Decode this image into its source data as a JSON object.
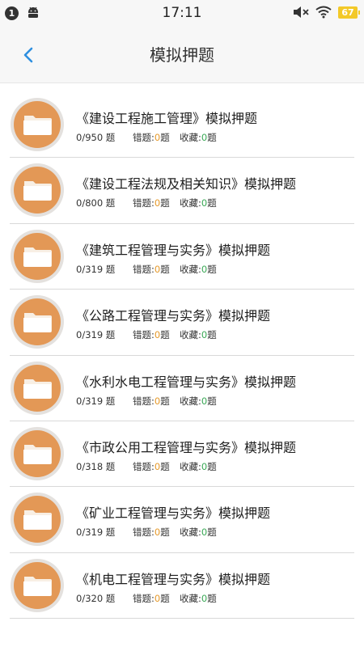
{
  "status_bar": {
    "notification_count": "1",
    "time": "17:11",
    "battery": "67",
    "icons": [
      "android-icon",
      "mute-icon",
      "wifi-icon",
      "battery-icon"
    ]
  },
  "header": {
    "title": "模拟押题",
    "back_icon": "chevron-left-icon"
  },
  "colors": {
    "accent": "#2e8fe0",
    "folder": "#e39856",
    "wrong_count": "#e69a2b",
    "fav_count": "#3aa856",
    "battery": "#f3c928"
  },
  "items": [
    {
      "title": "《建设工程施工管理》模拟押题",
      "progress": "0/950 题",
      "wrong_label": "错题:",
      "wrong_count": "0",
      "wrong_unit": "题",
      "fav_label": "收藏:",
      "fav_count": "0",
      "fav_unit": "题"
    },
    {
      "title": "《建设工程法规及相关知识》模拟押题",
      "progress": "0/800 题",
      "wrong_label": "错题:",
      "wrong_count": "0",
      "wrong_unit": "题",
      "fav_label": "收藏:",
      "fav_count": "0",
      "fav_unit": "题"
    },
    {
      "title": "《建筑工程管理与实务》模拟押题",
      "progress": "0/319 题",
      "wrong_label": "错题:",
      "wrong_count": "0",
      "wrong_unit": "题",
      "fav_label": "收藏:",
      "fav_count": "0",
      "fav_unit": "题"
    },
    {
      "title": "《公路工程管理与实务》模拟押题",
      "progress": "0/319 题",
      "wrong_label": "错题:",
      "wrong_count": "0",
      "wrong_unit": "题",
      "fav_label": "收藏:",
      "fav_count": "0",
      "fav_unit": "题"
    },
    {
      "title": "《水利水电工程管理与实务》模拟押题",
      "progress": "0/319 题",
      "wrong_label": "错题:",
      "wrong_count": "0",
      "wrong_unit": "题",
      "fav_label": "收藏:",
      "fav_count": "0",
      "fav_unit": "题"
    },
    {
      "title": "《市政公用工程管理与实务》模拟押题",
      "progress": "0/318 题",
      "wrong_label": "错题:",
      "wrong_count": "0",
      "wrong_unit": "题",
      "fav_label": "收藏:",
      "fav_count": "0",
      "fav_unit": "题"
    },
    {
      "title": "《矿业工程管理与实务》模拟押题",
      "progress": "0/319 题",
      "wrong_label": "错题:",
      "wrong_count": "0",
      "wrong_unit": "题",
      "fav_label": "收藏:",
      "fav_count": "0",
      "fav_unit": "题"
    },
    {
      "title": "《机电工程管理与实务》模拟押题",
      "progress": "0/320 题",
      "wrong_label": "错题:",
      "wrong_count": "0",
      "wrong_unit": "题",
      "fav_label": "收藏:",
      "fav_count": "0",
      "fav_unit": "题"
    }
  ]
}
